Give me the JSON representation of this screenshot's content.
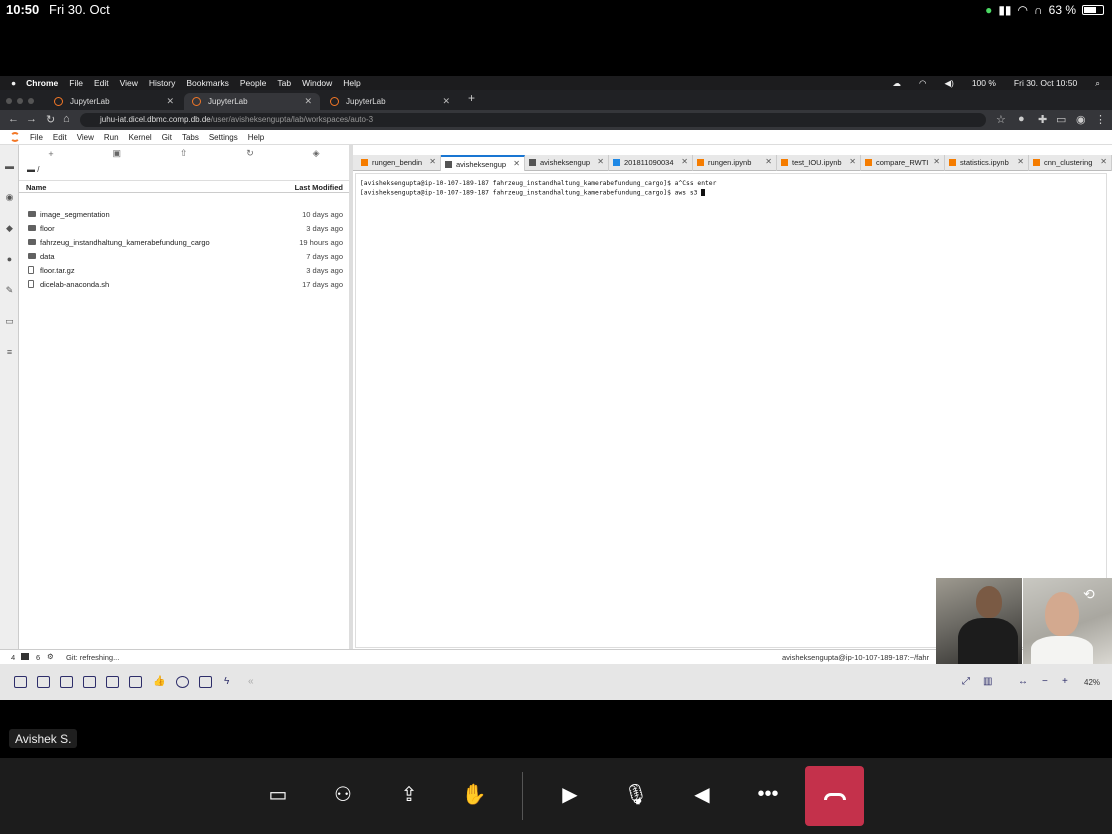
{
  "ios_status": {
    "time": "10:50",
    "date": "Fri 30. Oct",
    "battery": "63 %"
  },
  "mac_menu": {
    "app": "Chrome",
    "items": [
      "File",
      "Edit",
      "View",
      "History",
      "Bookmarks",
      "People",
      "Tab",
      "Window",
      "Help"
    ],
    "battery": "100 %",
    "datetime": "Fri 30. Oct  10:50"
  },
  "chrome": {
    "tabs": [
      {
        "label": "JupyterLab"
      },
      {
        "label": "JupyterLab"
      },
      {
        "label": "JupyterLab"
      }
    ],
    "url_host": "juhu-iat.dicel.dbmc.comp.db.de",
    "url_path": "/user/avisheksengupta/lab/workspaces/auto-3"
  },
  "jupyter": {
    "menu": [
      "File",
      "Edit",
      "View",
      "Run",
      "Kernel",
      "Git",
      "Tabs",
      "Settings",
      "Help"
    ],
    "breadcrumb": "/",
    "columns": {
      "name": "Name",
      "modified": "Last Modified"
    },
    "files": [
      {
        "name": "image_segmentation",
        "modified": "10 days ago",
        "type": "folder"
      },
      {
        "name": "floor",
        "modified": "3 days ago",
        "type": "folder"
      },
      {
        "name": "fahrzeug_instandhaltung_kamerabefundung_cargo",
        "modified": "19 hours ago",
        "type": "folder"
      },
      {
        "name": "data",
        "modified": "7 days ago",
        "type": "folder"
      },
      {
        "name": "floor.tar.gz",
        "modified": "3 days ago",
        "type": "file"
      },
      {
        "name": "dicelab-anaconda.sh",
        "modified": "17 days ago",
        "type": "file"
      }
    ],
    "doc_tabs": [
      {
        "label": "rungen_bendin",
        "kind": "nb"
      },
      {
        "label": "avisheksengup",
        "kind": "term",
        "active": true
      },
      {
        "label": "avisheksengup",
        "kind": "term"
      },
      {
        "label": "201811090034",
        "kind": "img"
      },
      {
        "label": "rungen.ipynb",
        "kind": "nb"
      },
      {
        "label": "test_IOU.ipynb",
        "kind": "nb"
      },
      {
        "label": "compare_RWTI",
        "kind": "nb"
      },
      {
        "label": "statistics.ipynb",
        "kind": "nb"
      },
      {
        "label": "cnn_clustering",
        "kind": "nb"
      }
    ],
    "terminal_lines": [
      "[avisheksengupta@ip-10-107-189-187 fahrzeug_instandhaltung_kamerabefundung_cargo]$ a^Css enter",
      "[avisheksengupta@ip-10-107-189-187 fahrzeug_instandhaltung_kamerabefundung_cargo]$ aws s3 "
    ],
    "status": {
      "count1": "4",
      "count2": "6",
      "git": "Git: refreshing...",
      "right": "avisheksengupta@ip-10-107-189-187:~/fahr"
    }
  },
  "whiteboard": {
    "zoom": "42%"
  },
  "participant": {
    "name": "Avishek S."
  }
}
